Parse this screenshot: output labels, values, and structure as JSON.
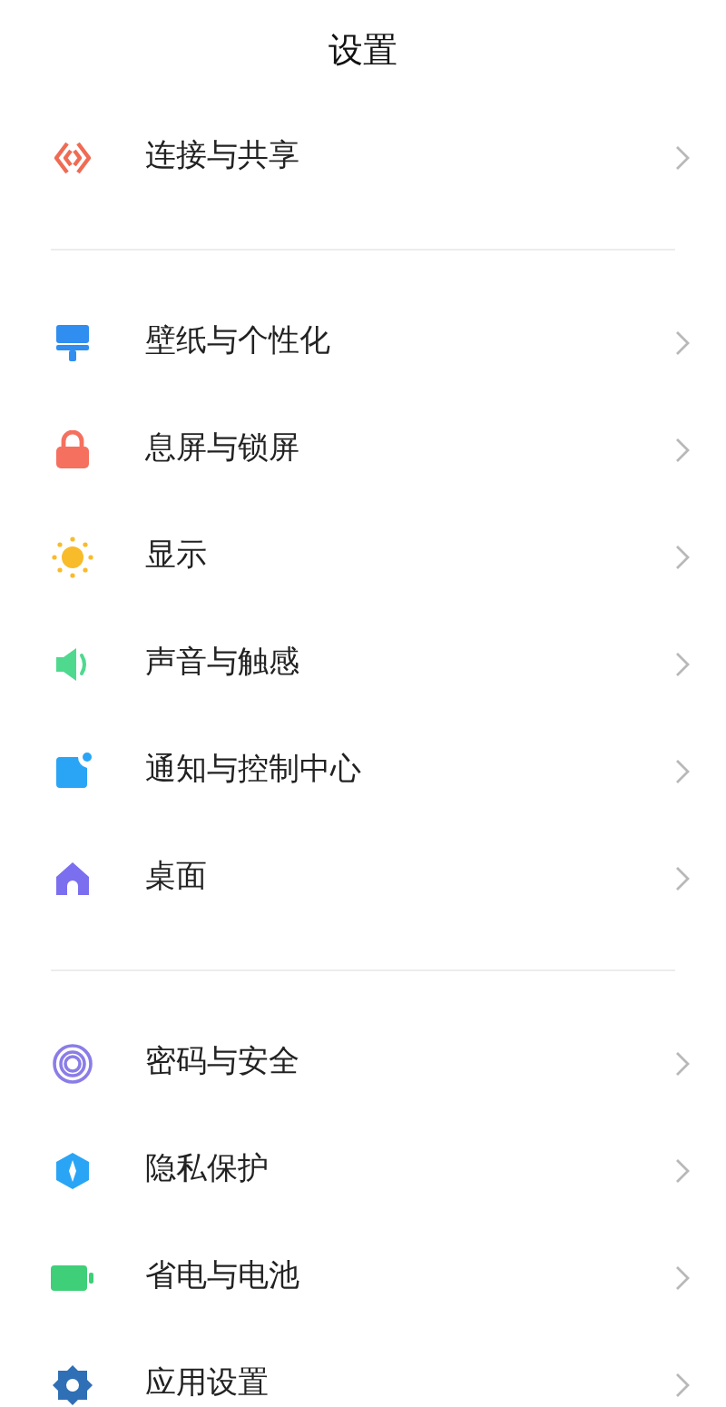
{
  "title": "设置",
  "groups": [
    {
      "items": [
        {
          "label": "连接与共享",
          "kind": "share"
        }
      ]
    },
    {
      "items": [
        {
          "label": "壁纸与个性化",
          "kind": "brush"
        },
        {
          "label": "息屏与锁屏",
          "kind": "lock"
        },
        {
          "label": "显示",
          "kind": "sun"
        },
        {
          "label": "声音与触感",
          "kind": "speaker"
        },
        {
          "label": "通知与控制中心",
          "kind": "notification"
        },
        {
          "label": "桌面",
          "kind": "home"
        }
      ]
    },
    {
      "items": [
        {
          "label": "密码与安全",
          "kind": "fingerprint"
        },
        {
          "label": "隐私保护",
          "kind": "shield"
        },
        {
          "label": "省电与电池",
          "kind": "battery"
        },
        {
          "label": "应用设置",
          "kind": "gear"
        }
      ]
    }
  ]
}
